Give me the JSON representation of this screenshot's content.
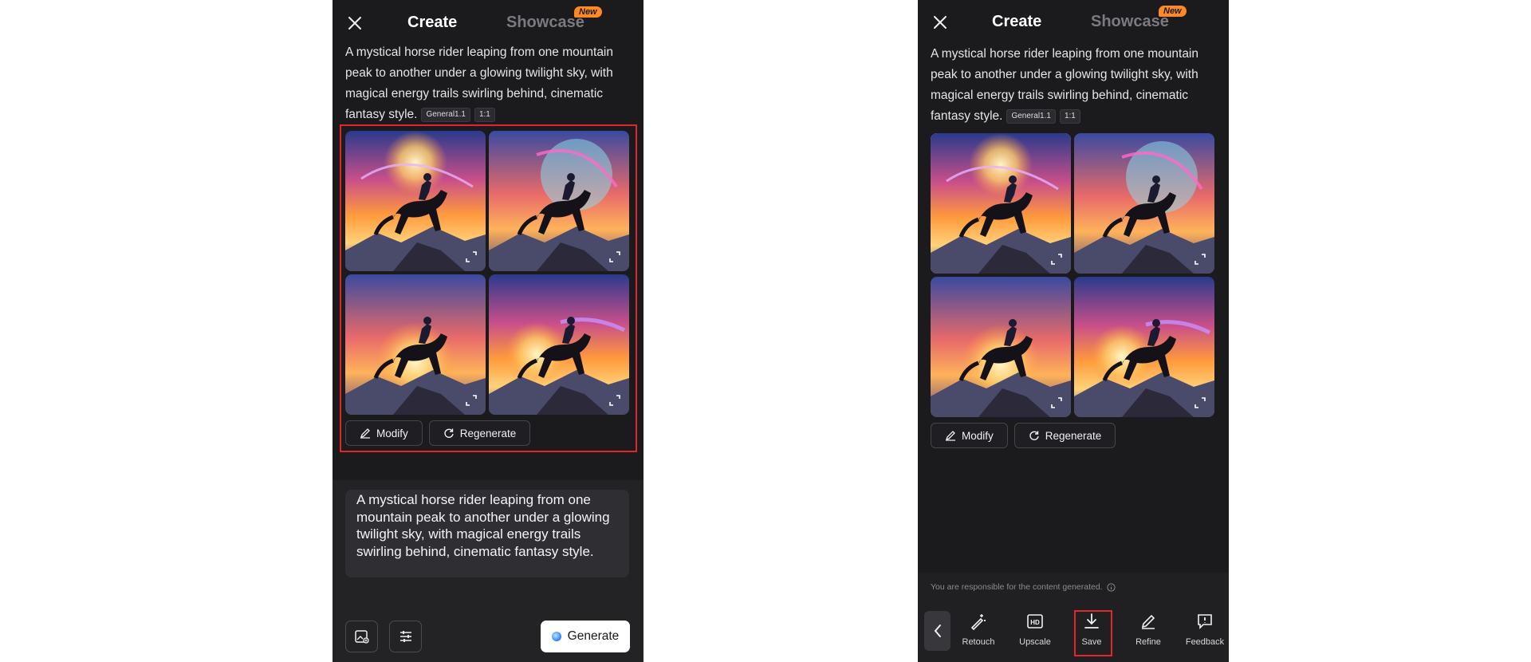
{
  "header": {
    "tab_create": "Create",
    "tab_showcase": "Showcase",
    "badge_new": "New"
  },
  "prompt": {
    "text": "A mystical horse rider leaping from one mountain peak to another under a glowing twilight sky, with magical energy trails swirling behind, cinematic fantasy style.",
    "model_tag": "General1.1",
    "ratio_tag": "1:1"
  },
  "actions": {
    "modify": "Modify",
    "regenerate": "Regenerate"
  },
  "composer": {
    "value": "A mystical horse rider leaping from one mountain peak to another under a glowing twilight sky, with magical energy trails swirling behind, cinematic fantasy style.",
    "generate_label": "Generate"
  },
  "result": {
    "disclaimer": "You are responsible for the content generated.",
    "tools": {
      "retouch": "Retouch",
      "upscale": "Upscale",
      "save": "Save",
      "refine": "Refine",
      "feedback": "Feedback"
    }
  },
  "colors": {
    "background": "#1b1b1e",
    "accent_badge": "#ff8a1f",
    "highlight": "#e3262d"
  }
}
